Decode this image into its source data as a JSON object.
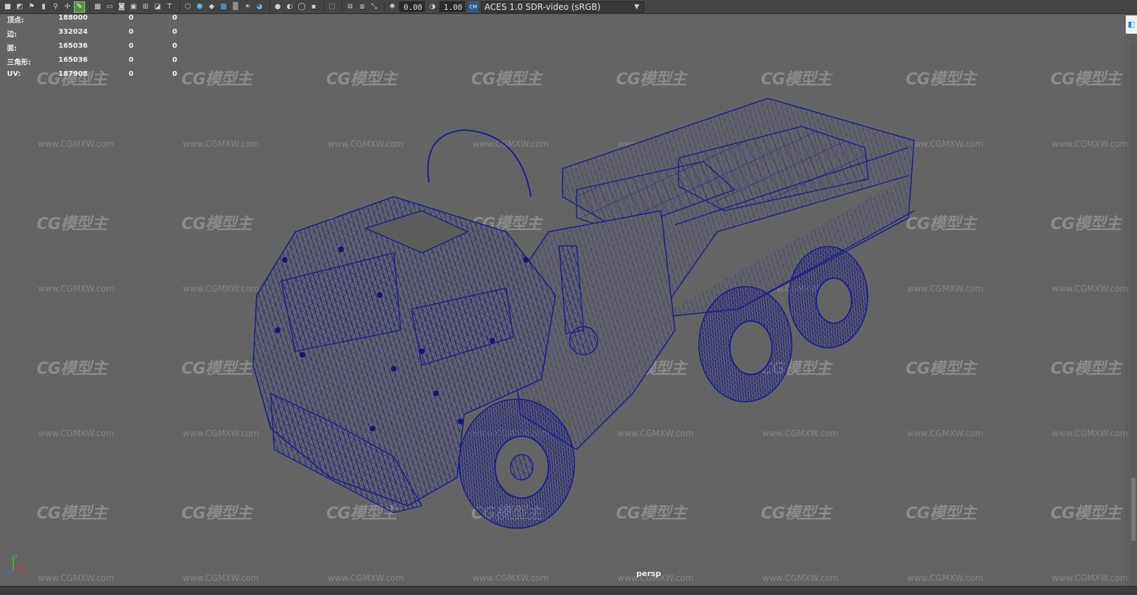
{
  "toolbar": {
    "exposure_value": "0.00",
    "gamma_value": "1.00",
    "colorspace": "ACES 1.0 SDR-video (sRGB)",
    "icons": [
      "camera-icon",
      "camera-attr-icon",
      "bookmark-icon",
      "image-plane-icon",
      "select-camera-icon",
      "grid-tool-icon",
      "pencil-icon",
      "grid-icon",
      "film-gate-icon",
      "resolution-gate-icon",
      "gate-mask-icon",
      "field-chart-icon",
      "safe-action-icon",
      "safe-title-icon",
      "wireframe-icon",
      "smooth-shade-icon",
      "wireframe-on-shaded-icon",
      "textured-icon",
      "lighting-icon",
      "shadows-icon",
      "screen-space-ao-icon",
      "motion-blur-icon",
      "anti-aliasing-icon",
      "depth-of-field-icon",
      "isolate-select-icon",
      "xray-icon",
      "xray-joints-icon",
      "xray-components-icon",
      "exposure-icon",
      "gamma-icon",
      "color-management-icon"
    ]
  },
  "hud": {
    "rows": [
      {
        "label": "顶点:",
        "total": "188000",
        "selected": "0",
        "extra": "0"
      },
      {
        "label": "边:",
        "total": "332024",
        "selected": "0",
        "extra": "0"
      },
      {
        "label": "面:",
        "total": "165036",
        "selected": "0",
        "extra": "0"
      },
      {
        "label": "三角形:",
        "total": "165036",
        "selected": "0",
        "extra": "0"
      },
      {
        "label": "UV:",
        "total": "187908",
        "selected": "0",
        "extra": "0"
      }
    ]
  },
  "viewport": {
    "camera": "persp",
    "background_color": "#646464",
    "wireframe_color": "#1a1f8c"
  },
  "watermark": {
    "logo": "CG模型主",
    "url": "www.CGMXW.com"
  },
  "axis": {
    "y": "y",
    "x": "x",
    "z": "z"
  }
}
